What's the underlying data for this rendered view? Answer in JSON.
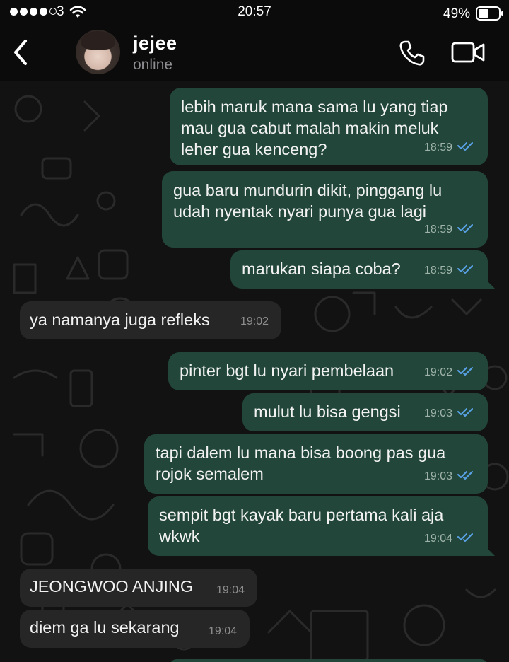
{
  "status_bar": {
    "carrier": "3",
    "time": "20:57",
    "battery": "49%"
  },
  "header": {
    "contact_name": "jejee",
    "contact_status": "online"
  },
  "messages": [
    {
      "direction": "out",
      "text": "lebih maruk mana sama lu yang tiap\nmau gua cabut malah makin meluk\nleher gua kenceng?",
      "time": "18:59",
      "read": true
    },
    {
      "direction": "out",
      "text": "gua baru mundurin dikit, pinggang lu\nudah nyentak nyari punya gua lagi",
      "time": "18:59",
      "read": true
    },
    {
      "direction": "out",
      "text": "marukan siapa coba?",
      "time": "18:59",
      "read": true
    },
    {
      "direction": "in",
      "text": "ya namanya juga refleks",
      "time": "19:02"
    },
    {
      "direction": "out",
      "text": "pinter bgt lu nyari pembelaan",
      "time": "19:02",
      "read": true
    },
    {
      "direction": "out",
      "text": "mulut lu bisa gengsi",
      "time": "19:03",
      "read": true
    },
    {
      "direction": "out",
      "text": "tapi dalem lu mana bisa boong pas gua\nrojok semalem",
      "time": "19:03",
      "read": true
    },
    {
      "direction": "out",
      "text": "sempit bgt kayak baru pertama kali aja\nwkwk",
      "time": "19:04",
      "read": true
    },
    {
      "direction": "in",
      "text": "JEONGWOO ANJING",
      "time": "19:04"
    },
    {
      "direction": "in",
      "text": "diem ga lu sekarang",
      "time": "19:04"
    }
  ],
  "colors": {
    "outgoing_bubble": "#22473a",
    "incoming_bubble": "#262626",
    "read_ticks": "#5aa2e8"
  }
}
